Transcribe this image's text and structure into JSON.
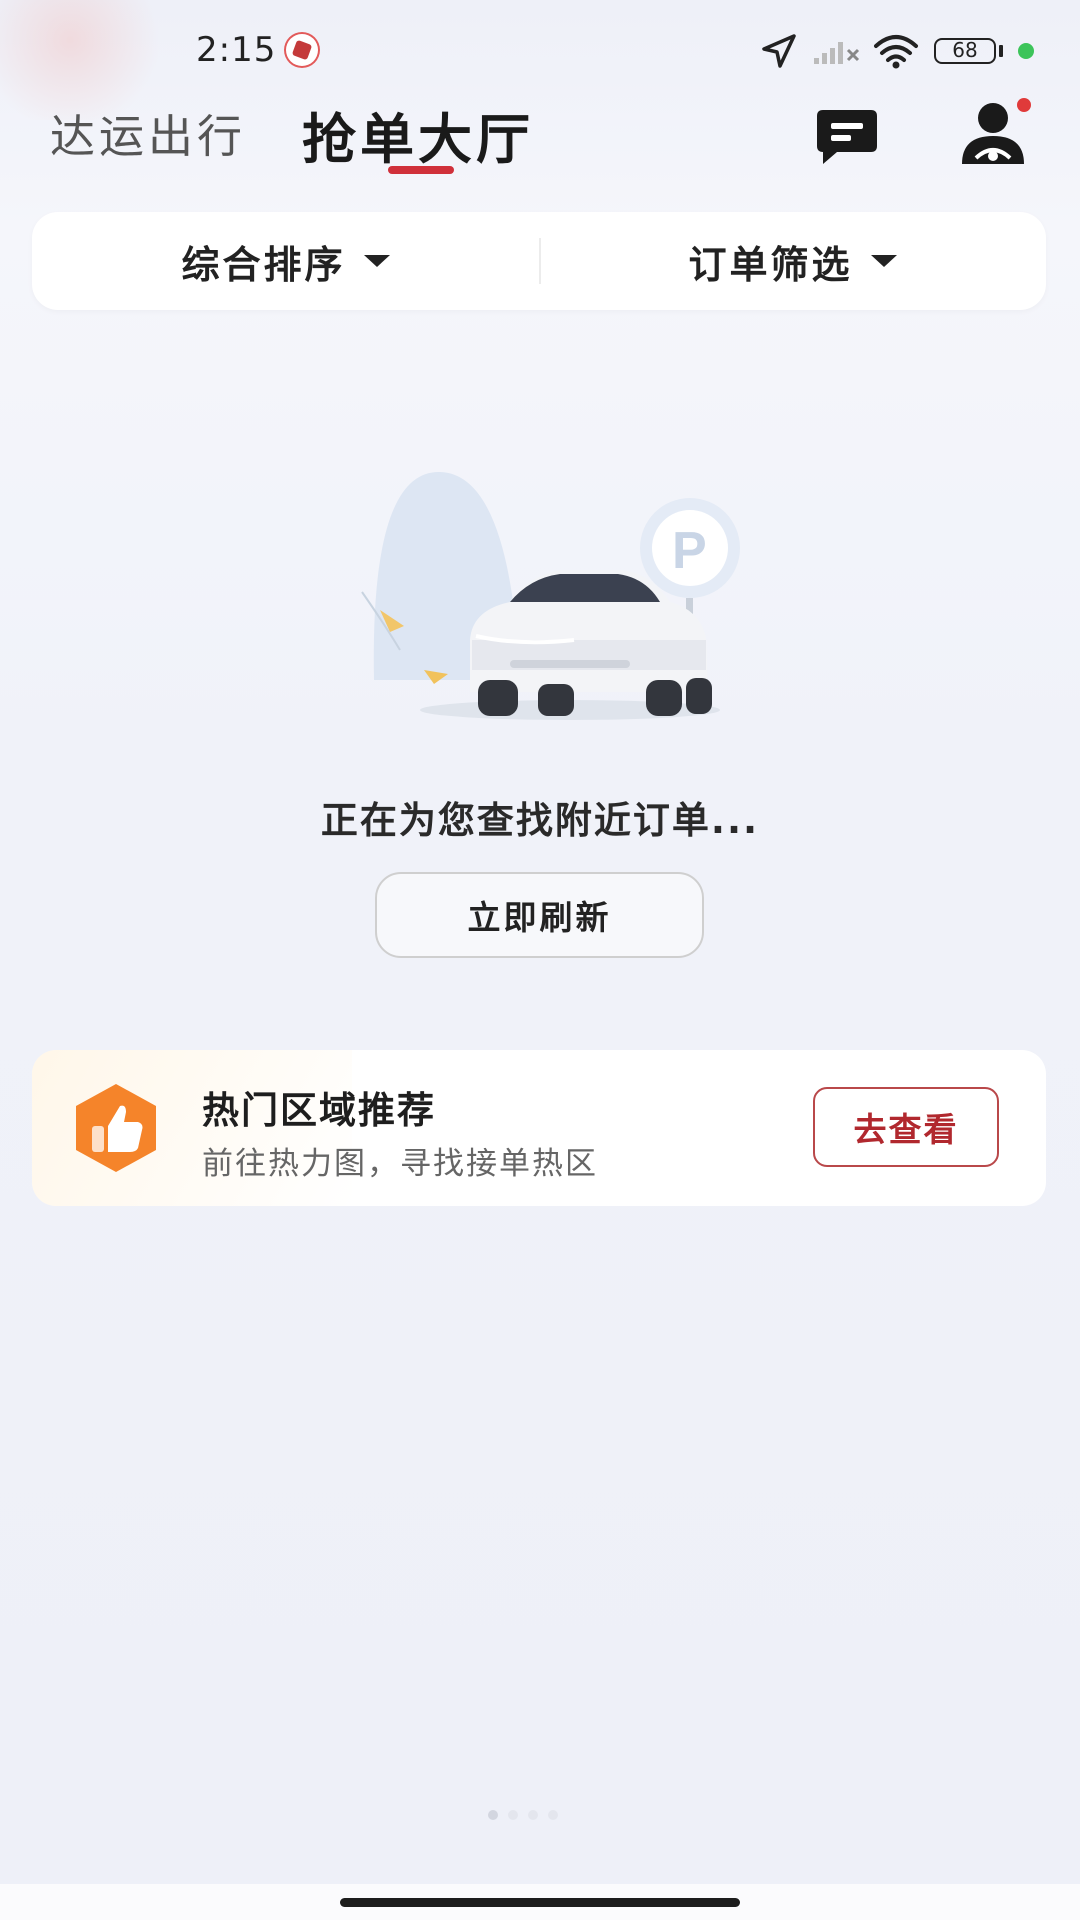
{
  "status_bar": {
    "time": "2:15",
    "battery": "68",
    "icons": [
      "app-notification-icon",
      "location-arrow-icon",
      "signal-icon",
      "wifi-icon",
      "battery-icon"
    ]
  },
  "header": {
    "tabs": [
      {
        "label": "达运出行",
        "active": false
      },
      {
        "label": "抢单大厅",
        "active": true
      }
    ],
    "accent_color": "#d0303a",
    "icons": [
      "message-icon",
      "driver-profile-icon"
    ]
  },
  "filters": {
    "sort_label": "综合排序",
    "filter_label": "订单筛选"
  },
  "empty_state": {
    "illustration": "car-parking-illustration",
    "message": "正在为您查找附近订单...",
    "refresh_label": "立即刷新"
  },
  "hot_area": {
    "title": "热门区域推荐",
    "subtitle": "前往热力图，寻找接单热区",
    "button_label": "去查看",
    "icon": "thumbs-up-icon",
    "icon_color": "#f5842a",
    "button_color": "#b1282e"
  }
}
